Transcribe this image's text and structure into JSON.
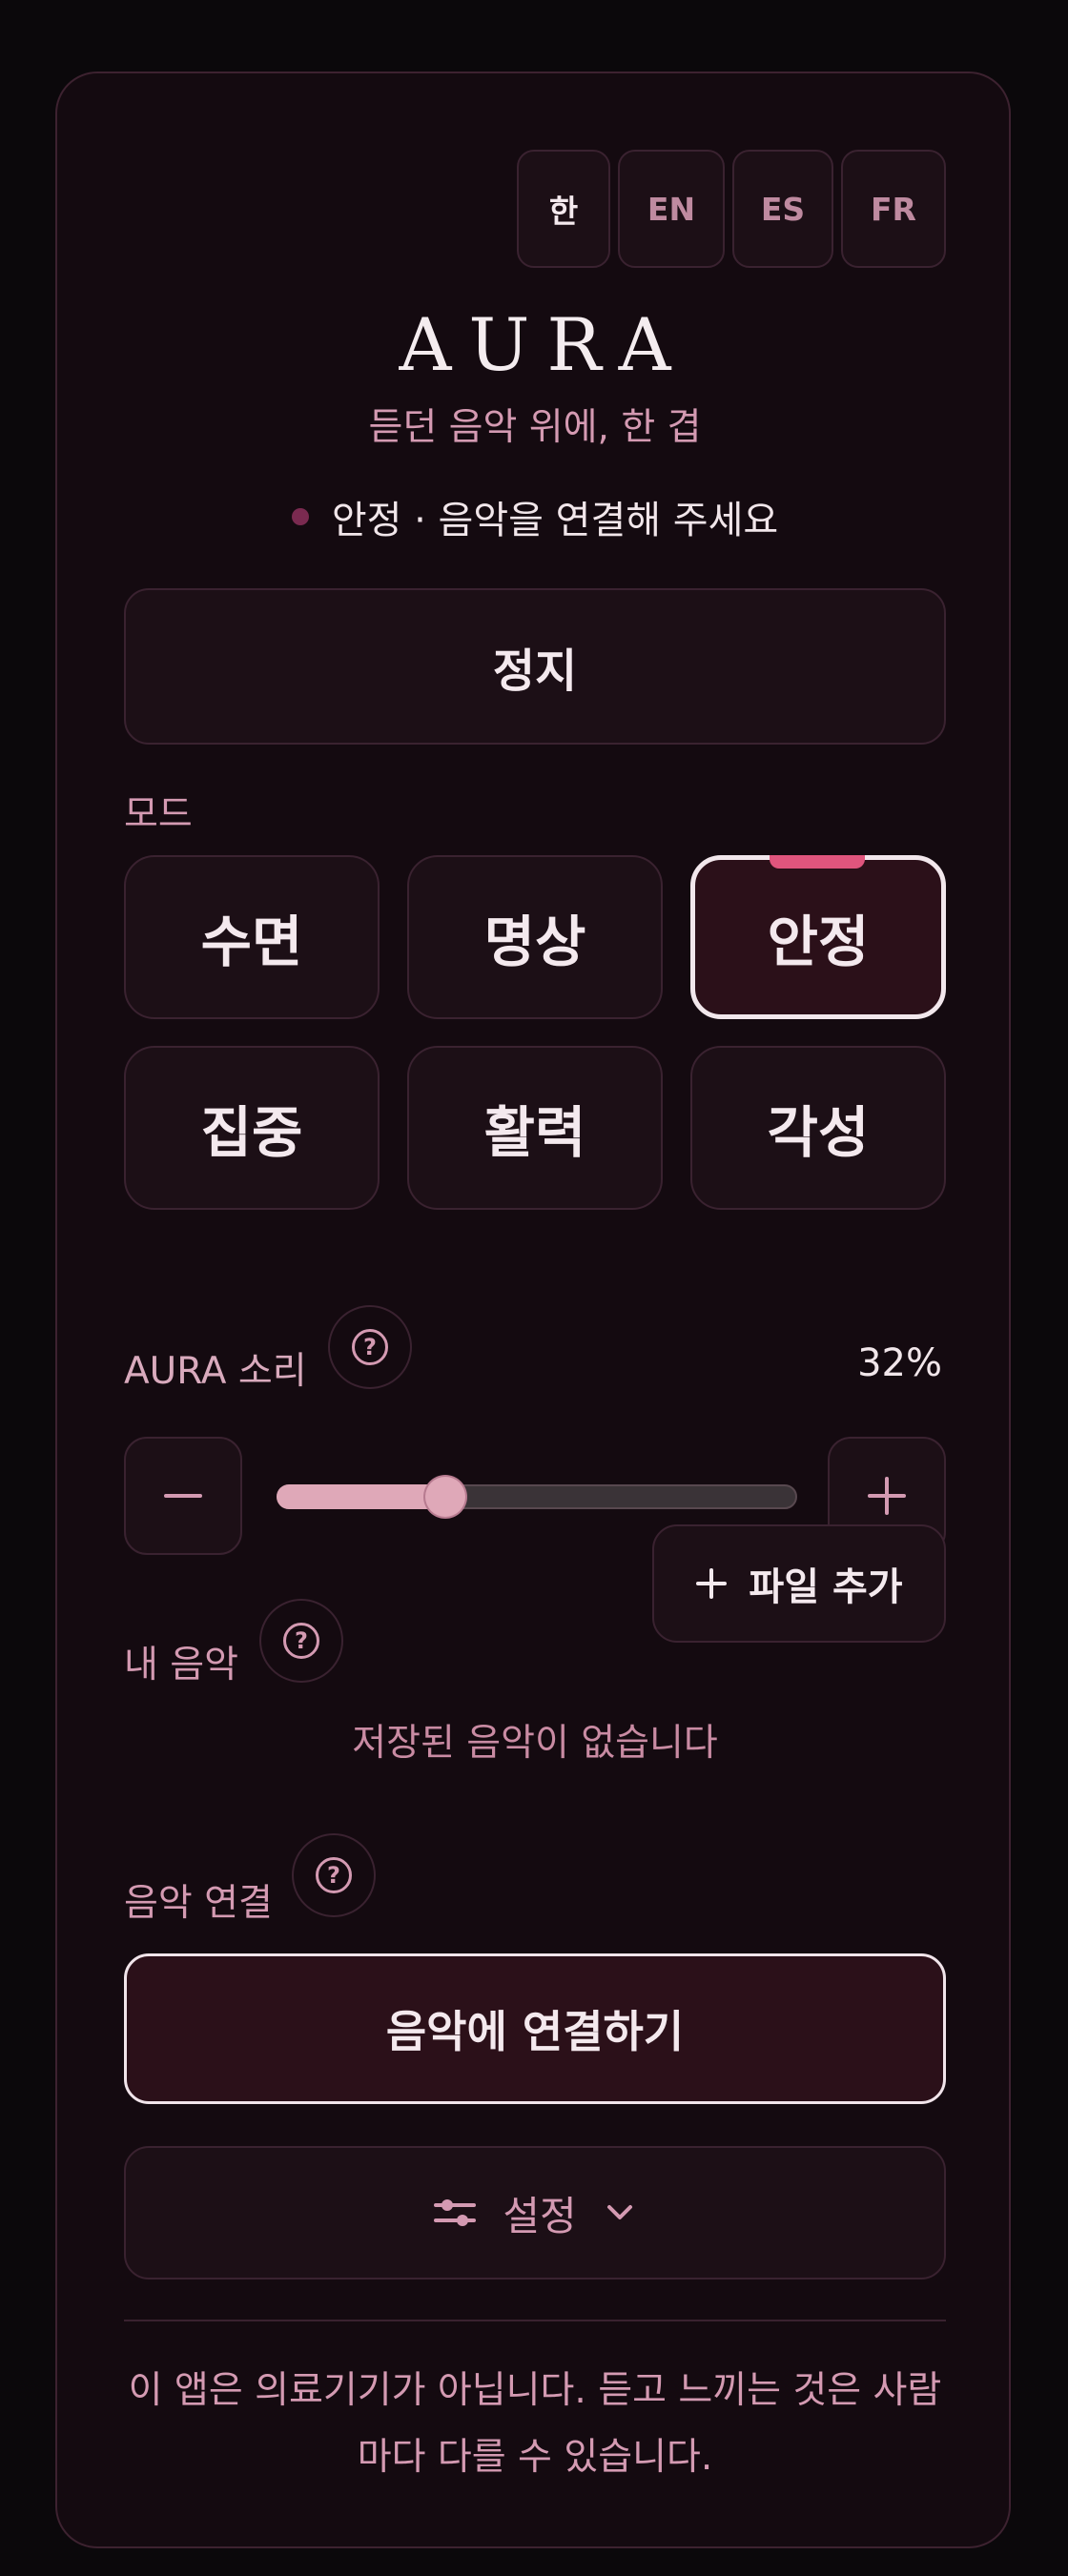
{
  "languages": [
    {
      "label": "한",
      "active": true
    },
    {
      "label": "EN",
      "active": false
    },
    {
      "label": "ES",
      "active": false
    },
    {
      "label": "FR",
      "active": false
    }
  ],
  "app": {
    "title": "AURA",
    "tagline": "듣던 음악 위에, 한 겹"
  },
  "status": {
    "text": "안정 · 음악을 연결해 주세요"
  },
  "stop_label": "정지",
  "modes": {
    "label": "모드",
    "items": [
      "수면",
      "명상",
      "안정",
      "집중",
      "활력",
      "각성"
    ],
    "selected": "안정"
  },
  "aura_sound": {
    "label": "AURA 소리",
    "percent_text": "32%",
    "value": 0.32
  },
  "my_music": {
    "label": "내 음악",
    "add_label": "파일 추가",
    "empty_text": "저장된 음악이 없습니다"
  },
  "music_connect": {
    "label": "음악 연결",
    "button_label": "음악에 연결하기"
  },
  "settings_label": "설정",
  "disclaimer": "이 앱은 의료기기가 아닙니다. 듣고 느끼는 것은 사람마다 다를 수 있습니다.",
  "colors": {
    "accent": "#e0557d",
    "text_muted": "#d49ab2",
    "slider": "#dfa8b8"
  }
}
